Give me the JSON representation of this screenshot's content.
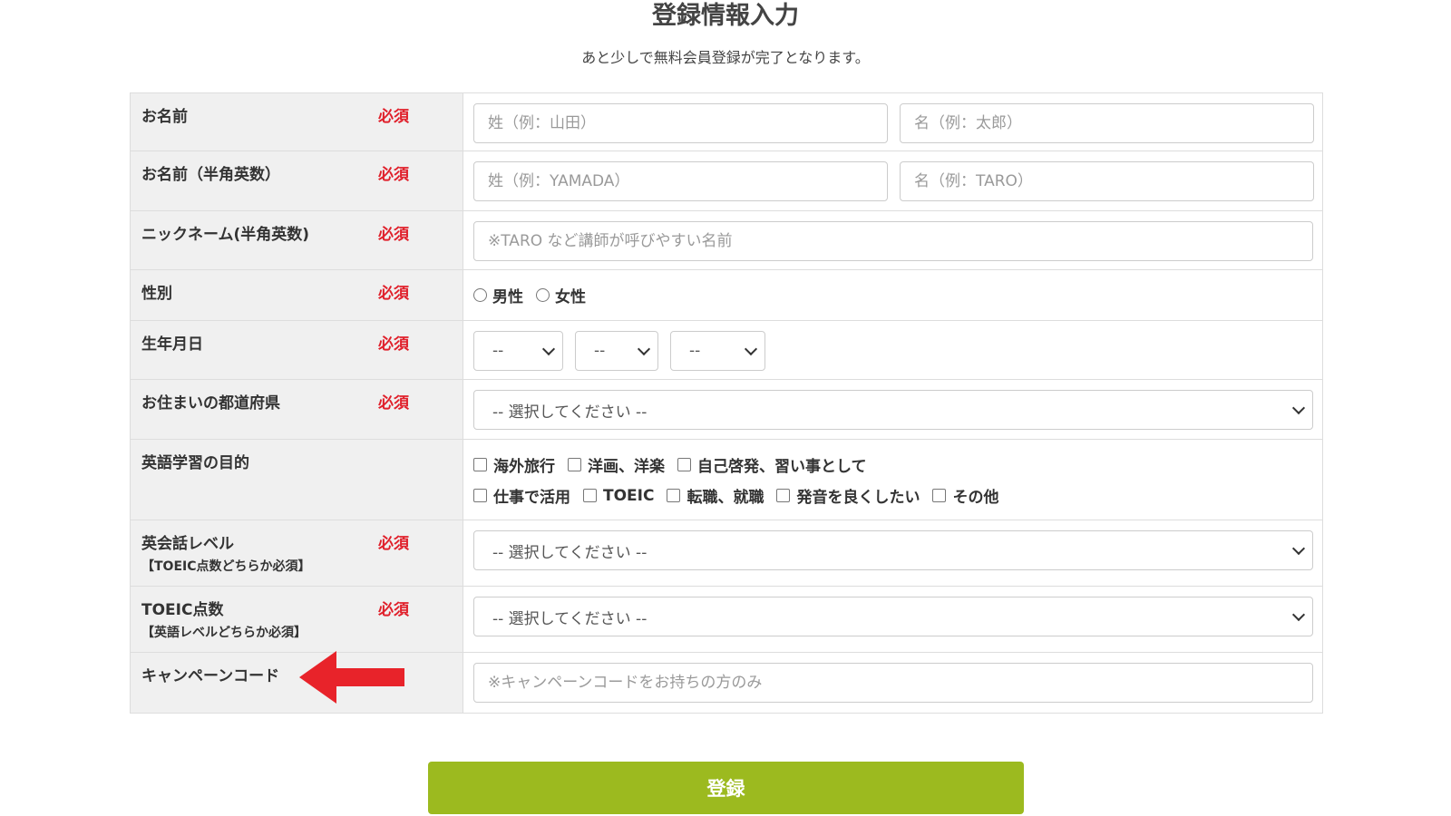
{
  "page": {
    "title": "登録情報入力",
    "subtitle": "あと少しで無料会員登録が完了となります。"
  },
  "required_label": "必須",
  "form": {
    "name": {
      "label": "お名前",
      "last_placeholder": "姓（例：山田）",
      "first_placeholder": "名（例：太郎）"
    },
    "name_roman": {
      "label": "お名前（半角英数）",
      "last_placeholder": "姓（例：YAMADA）",
      "first_placeholder": "名（例：TARO）"
    },
    "nickname": {
      "label": "ニックネーム(半角英数)",
      "placeholder": "※TARO など講師が呼びやすい名前"
    },
    "gender": {
      "label": "性別",
      "options": [
        "男性",
        "女性"
      ]
    },
    "birthday": {
      "label": "生年月日",
      "year": "--",
      "month": "--",
      "day": "--"
    },
    "prefecture": {
      "label": "お住まいの都道府県",
      "value": "-- 選択してください --"
    },
    "purpose": {
      "label": "英語学習の目的",
      "options_row1": [
        "海外旅行",
        "洋画、洋楽",
        "自己啓発、習い事として"
      ],
      "options_row2": [
        "仕事で活用",
        "TOEIC",
        "転職、就職",
        "発音を良くしたい",
        "その他"
      ]
    },
    "english_level": {
      "label": "英会話レベル",
      "sublabel": "【TOEIC点数どちらか必須】",
      "value": "-- 選択してください --"
    },
    "toeic": {
      "label": "TOEIC点数",
      "sublabel": "【英語レベルどちらか必須】",
      "value": "-- 選択してください --"
    },
    "campaign": {
      "label": "キャンペーンコード",
      "placeholder": "※キャンペーンコードをお持ちの方のみ"
    }
  },
  "submit_label": "登録",
  "colors": {
    "required": "#e0202b",
    "submit": "#9cba1f",
    "arrow": "#e8232a",
    "label_bg": "#f0f0f0"
  }
}
